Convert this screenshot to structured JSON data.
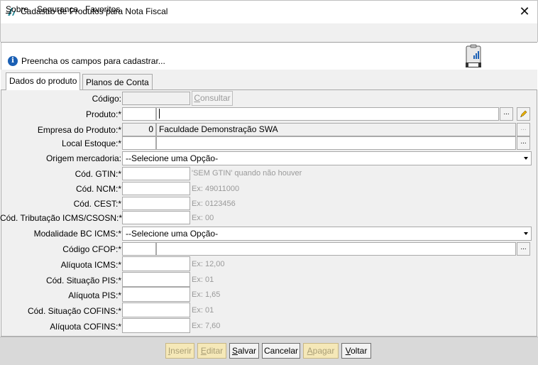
{
  "window": {
    "title": "Cadastro de Produtos para Nota Fiscal",
    "close_glyph": "✕"
  },
  "menu": {
    "items": [
      {
        "mnemonic": "S",
        "rest": "obre"
      },
      {
        "mnemonic": "",
        "rest": "Segurança"
      },
      {
        "mnemonic": "",
        "rest": "Favoritos"
      }
    ]
  },
  "info": {
    "icon_glyph": "i",
    "message": "Preencha os campos para cadastrar..."
  },
  "tabs": [
    {
      "label": "Dados do produto",
      "active": true
    },
    {
      "label": "Planos de Conta",
      "active": false
    }
  ],
  "form": {
    "codigo": {
      "label": "Código:",
      "value": ""
    },
    "consultar": {
      "mnemonic": "C",
      "rest": "onsultar"
    },
    "produto": {
      "label": "Produto:*",
      "code": "",
      "name": ""
    },
    "empresa": {
      "label": "Empresa do Produto:*",
      "code": "0",
      "name": "Faculdade Demonstração SWA"
    },
    "estoque": {
      "label": "Local Estoque:*",
      "code": "",
      "name": ""
    },
    "origem": {
      "label": "Origem mercadoria:",
      "selected": "--Selecione uma Opção-"
    },
    "gtin": {
      "label": "Cód. GTIN:*",
      "value": "",
      "hint": "'SEM GTIN' quando não houver"
    },
    "ncm": {
      "label": "Cód. NCM:*",
      "value": "",
      "hint": "Ex: 49011000"
    },
    "cest": {
      "label": "Cód. CEST:*",
      "value": "",
      "hint": "Ex: 0123456"
    },
    "tributacao": {
      "label": "Cód. Tributação ICMS/CSOSN:*",
      "value": "",
      "hint": "Ex: 00"
    },
    "modalidade": {
      "label": "Modalidade BC ICMS:*",
      "selected": "--Selecione uma Opção-"
    },
    "cfop": {
      "label": "Código CFOP:*",
      "code": "",
      "name": ""
    },
    "aliq_icms": {
      "label": "Alíquota ICMS:*",
      "value": "",
      "hint": "Ex: 12,00"
    },
    "sit_pis": {
      "label": "Cód. Situação PIS:*",
      "value": "",
      "hint": "Ex: 01"
    },
    "aliq_pis": {
      "label": "Alíquota PIS:*",
      "value": "",
      "hint": "Ex: 1,65"
    },
    "sit_cofins": {
      "label": "Cód. Situação COFINS:*",
      "value": "",
      "hint": "Ex: 01"
    },
    "aliq_cofins": {
      "label": "Alíquota COFINS:*",
      "value": "",
      "hint": "Ex: 7,60"
    },
    "lookup_glyph": "..."
  },
  "actions": {
    "inserir": {
      "mnemonic": "I",
      "rest": "nserir",
      "enabled": false
    },
    "editar": {
      "mnemonic": "E",
      "rest": "ditar",
      "enabled": false
    },
    "salvar": {
      "mnemonic": "S",
      "rest": "alvar",
      "enabled": true
    },
    "cancelar": {
      "mnemonic": "",
      "rest": "Cancelar",
      "enabled": true
    },
    "apagar": {
      "mnemonic": "A",
      "rest": "pagar",
      "enabled": false
    },
    "voltar": {
      "mnemonic": "V",
      "rest": "oltar",
      "enabled": true
    }
  },
  "colors": {
    "accent": "#1a5fb4",
    "disabled_button_bg": "#f5e8b8",
    "hint_text": "#9a9a9a"
  }
}
